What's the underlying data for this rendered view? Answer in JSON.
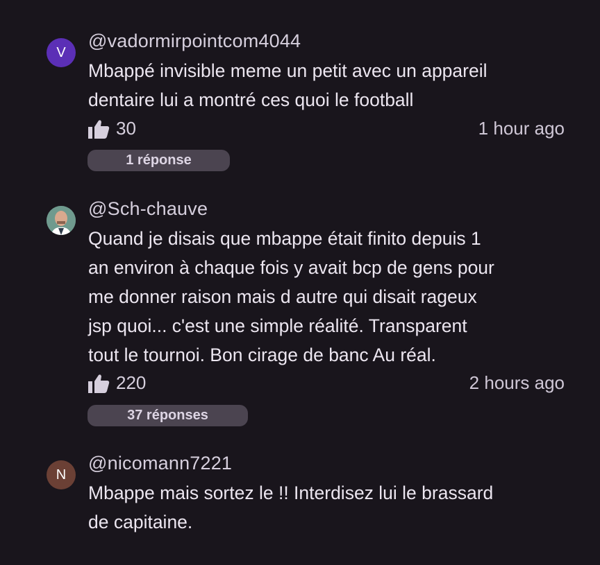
{
  "comments": [
    {
      "author": "@vadormirpointcom4044",
      "avatar_letter": "V",
      "avatar_color": "#5b2fb6",
      "lines": [
        "Mbappé invisible meme un petit avec un appareil",
        "dentaire lui a montré ces quoi le football"
      ],
      "likes": "30",
      "time": "1 hour ago",
      "replies": "1 réponse"
    },
    {
      "author": "@Sch-chauve",
      "avatar_letter": "",
      "avatar_color": "#6d8f86",
      "lines": [
        "Quand je disais que mbappe était finito depuis 1",
        "an environ à chaque fois y avait bcp de gens pour",
        "me donner raison mais d autre qui disait rageux",
        "jsp quoi... c'est une simple réalité. Transparent",
        "tout le tournoi. Bon cirage de banc Au réal."
      ],
      "likes": "220",
      "time": "2 hours ago",
      "replies": "37 réponses"
    },
    {
      "author": "@nicomann7221",
      "avatar_letter": "N",
      "avatar_color": "#6b4035",
      "lines": [
        "Mbappe mais sortez le !! Interdisez lui le brassard",
        "de capitaine."
      ]
    }
  ]
}
